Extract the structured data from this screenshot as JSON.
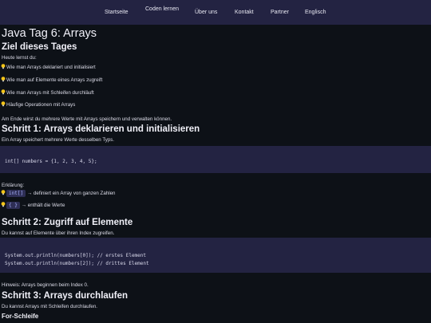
{
  "nav": {
    "items": [
      {
        "label": "Startseite"
      },
      {
        "label": "Coden lernen"
      },
      {
        "label": "Über uns"
      },
      {
        "label": "Kontakt"
      },
      {
        "label": "Partner"
      },
      {
        "label": "Englisch"
      }
    ]
  },
  "page": {
    "title": "Java Tag 6: Arrays"
  },
  "goal": {
    "heading": "Ziel dieses Tages",
    "intro": "Heute lernst du:",
    "items": [
      "Wie man Arrays deklariert und initialisiert",
      "Wie man auf Elemente eines Arrays zugreift",
      "Wie man Arrays mit Schleifen durchläuft",
      "Häufige Operationen mit Arrays"
    ],
    "outro": "Am Ende wirst du mehrere Werte mit Arrays speichern und verwalten können."
  },
  "step1": {
    "heading": "Schritt 1: Arrays deklarieren und initialisieren",
    "text": "Ein Array speichert mehrere Werte desselben Typs.",
    "code": "int[] numbers = {1, 2, 3, 4, 5};",
    "explain_label": "Erklärung:",
    "explain": [
      {
        "code": "int[]",
        "text": "→ definiert ein Array von ganzen Zahlen"
      },
      {
        "code": "{ }",
        "text": "→ enthält die Werte"
      }
    ]
  },
  "step2": {
    "heading": "Schritt 2: Zugriff auf Elemente",
    "text": "Du kannst auf Elemente über ihren Index zugreifen.",
    "code_lines": [
      "System.out.println(numbers[0]); // erstes Element",
      "System.out.println(numbers[2]); // drittes Element"
    ],
    "hint": "Hinweis: Arrays beginnen beim Index 0."
  },
  "step3": {
    "heading": "Schritt 3: Arrays durchlaufen",
    "text": "Du kannst Arrays mit Schleifen durchlaufen.",
    "subheading": "For-Schleife"
  },
  "icons": {
    "bullet": "lightbulb-icon"
  },
  "colors": {
    "background": "#0d1117",
    "nav_background": "#232342",
    "code_background": "#232342",
    "inline_code_text": "#a9b4ff",
    "bulb": "#f5c518"
  }
}
